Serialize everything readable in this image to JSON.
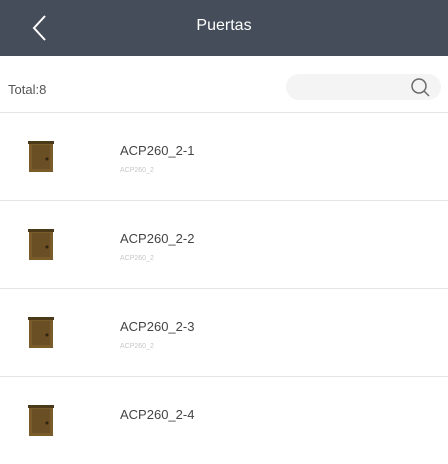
{
  "header": {
    "title": "Puertas",
    "back_icon": "chevron-left-icon"
  },
  "summary": {
    "total_label": "Total:8"
  },
  "search": {
    "placeholder": "",
    "icon": "search-icon"
  },
  "doors": [
    {
      "name": "ACP260_2-1",
      "sub": "ACP260_2"
    },
    {
      "name": "ACP260_2-2",
      "sub": "ACP260_2"
    },
    {
      "name": "ACP260_2-3",
      "sub": "ACP260_2"
    },
    {
      "name": "ACP260_2-4",
      "sub": ""
    }
  ],
  "colors": {
    "header_bg": "#454d5a",
    "door_icon": "#7a5c2b"
  }
}
